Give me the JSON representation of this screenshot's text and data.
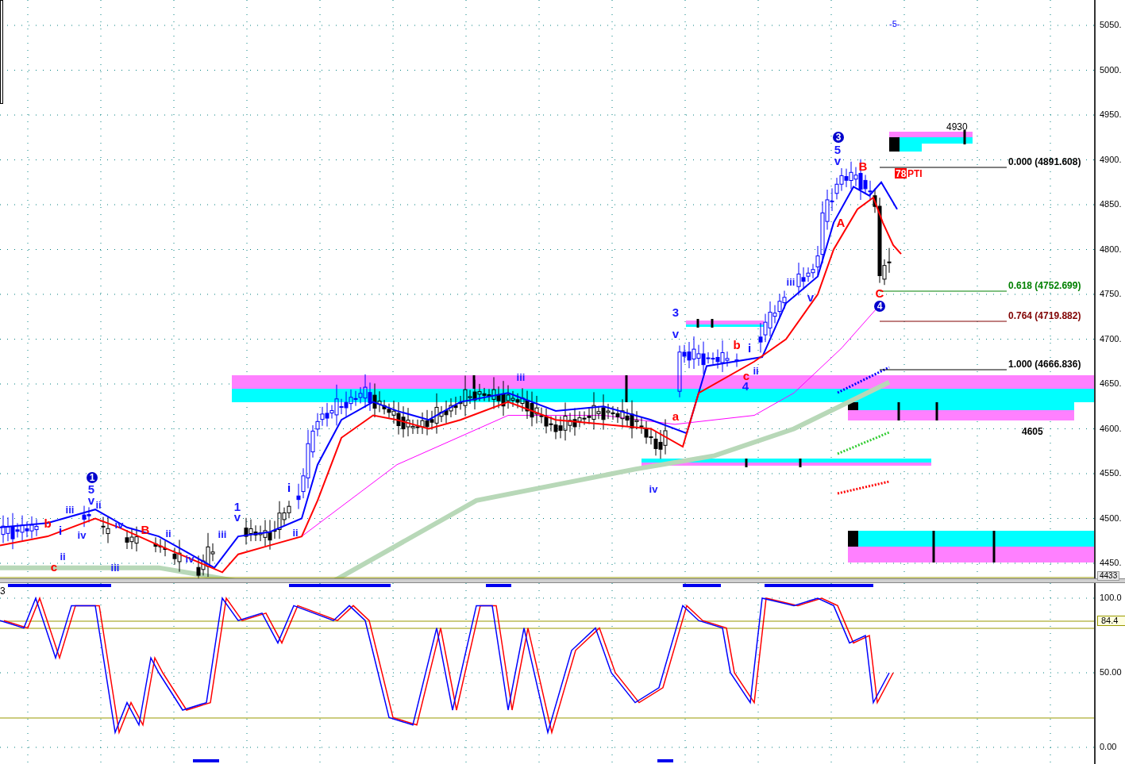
{
  "price_axis": {
    "ticks": [
      "5050.",
      "5000.",
      "4950.",
      "4900.",
      "4850.",
      "4800.",
      "4750.",
      "4700.",
      "4650.",
      "4600.",
      "4550.",
      "4500.",
      "4450."
    ],
    "current": "4433"
  },
  "top_marker": "-5-",
  "wave_labels": [
    {
      "text": "1",
      "color": "#0000cc",
      "kind": "circle"
    },
    {
      "text": "5",
      "color": "#1a1aff",
      "kind": "plain"
    },
    {
      "text": "v",
      "color": "#1a1aff",
      "kind": "plain"
    },
    {
      "text": "ii",
      "color": "#1a1aff",
      "kind": "plain"
    },
    {
      "text": "iii",
      "color": "#1a1aff",
      "kind": "plain"
    },
    {
      "text": "b",
      "color": "#ff0000",
      "kind": "plain"
    },
    {
      "text": "i",
      "color": "#0000ff",
      "kind": "plain"
    },
    {
      "text": "iv",
      "color": "#1a1aff",
      "kind": "plain"
    },
    {
      "text": "ii",
      "color": "#1a1aff",
      "kind": "plain"
    },
    {
      "text": "c",
      "color": "#ff0000",
      "kind": "plain"
    },
    {
      "text": "iv",
      "color": "#1a1aff",
      "kind": "plain"
    },
    {
      "text": "B",
      "color": "#ff0000",
      "kind": "plain"
    },
    {
      "text": "ii",
      "color": "#1a1aff",
      "kind": "plain"
    },
    {
      "text": "iii",
      "color": "#1a1aff",
      "kind": "plain"
    },
    {
      "text": "iv",
      "color": "#1a1aff",
      "kind": "plain"
    },
    {
      "text": "1",
      "color": "#1a1aff",
      "kind": "plain"
    },
    {
      "text": "v",
      "color": "#1a1aff",
      "kind": "plain"
    },
    {
      "text": "iii",
      "color": "#1a1aff",
      "kind": "plain"
    },
    {
      "text": "i",
      "color": "#0000ff",
      "kind": "plain"
    },
    {
      "text": "ii",
      "color": "#1a1aff",
      "kind": "plain"
    },
    {
      "text": "iii",
      "color": "#1a1aff",
      "kind": "plain"
    },
    {
      "text": "3",
      "color": "#1a1aff",
      "kind": "plain"
    },
    {
      "text": "v",
      "color": "#1a1aff",
      "kind": "plain"
    },
    {
      "text": "b",
      "color": "#ff0000",
      "kind": "plain"
    },
    {
      "text": "i",
      "color": "#0000ff",
      "kind": "plain"
    },
    {
      "text": "ii",
      "color": "#1a1aff",
      "kind": "plain"
    },
    {
      "text": "c",
      "color": "#ff0000",
      "kind": "plain"
    },
    {
      "text": "4",
      "color": "#1a1aff",
      "kind": "plain"
    },
    {
      "text": "a",
      "color": "#ff0000",
      "kind": "plain"
    },
    {
      "text": "iv",
      "color": "#1a1aff",
      "kind": "plain"
    },
    {
      "text": "iii",
      "color": "#1a1aff",
      "kind": "plain"
    },
    {
      "text": "v",
      "color": "#1a1aff",
      "kind": "plain"
    },
    {
      "text": "3",
      "color": "#0000cc",
      "kind": "circle"
    },
    {
      "text": "5",
      "color": "#1a1aff",
      "kind": "plain"
    },
    {
      "text": "v",
      "color": "#1a1aff",
      "kind": "plain"
    },
    {
      "text": "B",
      "color": "#ff0000",
      "kind": "plain"
    },
    {
      "text": "A",
      "color": "#ff0000",
      "kind": "plain"
    },
    {
      "text": "C",
      "color": "#ff0000",
      "kind": "plain"
    },
    {
      "text": "4",
      "color": "#0000cc",
      "kind": "circle"
    }
  ],
  "fib_levels": [
    {
      "label": "0.000 (4891.608)",
      "color": "#000000"
    },
    {
      "label": "0.618 (4752.699)",
      "color": "#008000"
    },
    {
      "label": "0.764 (4719.882)",
      "color": "#800000"
    },
    {
      "label": "1.000 (4666.836)",
      "color": "#000000"
    }
  ],
  "zone_labels": [
    "4930",
    "4605"
  ],
  "badge": {
    "number": "78",
    "text": "PTI"
  },
  "oscillator": {
    "title": "3",
    "ticks": [
      "100.0",
      "50.00",
      "0.00"
    ],
    "reading": "84.4"
  }
}
